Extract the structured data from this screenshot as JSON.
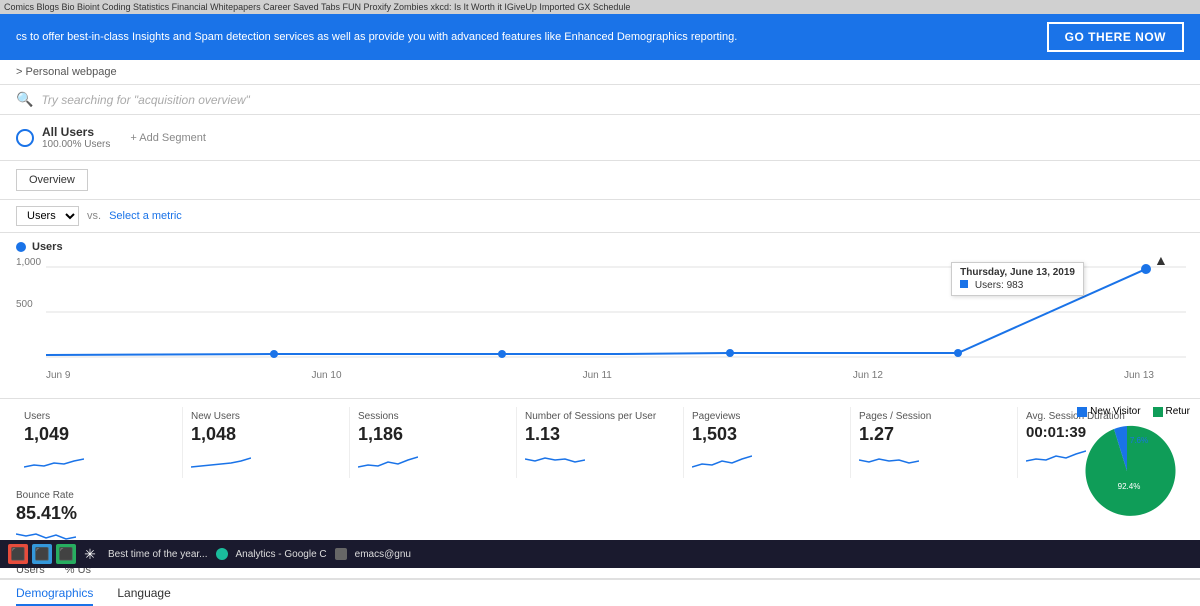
{
  "browser": {
    "tabs": "Comics  Blogs  Bio  Bioint  Coding  Statistics  Financial  Whitepapers  Career  Saved Tabs  FUN  Proxify  Zombies  xkcd: Is It Worth it  IGiveUp  Imported  GX Schedule"
  },
  "notification": {
    "message": "cs to offer best-in-class Insights and Spam detection services as well as provide you with advanced features like Enhanced Demographics reporting.",
    "cta_label": "GO THERE NOW"
  },
  "breadcrumb": {
    "label": "> Personal webpage"
  },
  "search": {
    "placeholder": "Try searching for \"acquisition overview\""
  },
  "segments": {
    "all_users_label": "All Users",
    "all_users_sub": "100.00% Users",
    "add_segment_label": "+ Add Segment"
  },
  "tabs": {
    "overview_label": "Overview"
  },
  "metrics": {
    "dimension": "Users",
    "vs_label": "vs.",
    "select_label": "Select a metric"
  },
  "chart": {
    "legend_label": "Users",
    "y_labels": [
      "1,000",
      "500"
    ],
    "x_labels": [
      "Jun 9",
      "Jun 10",
      "Jun 11",
      "Jun 12",
      "Jun 13"
    ],
    "tooltip": {
      "date": "Thursday, June 13, 2019",
      "metric": "Users: 983"
    }
  },
  "stats": [
    {
      "label": "Users",
      "value": "1,049"
    },
    {
      "label": "New Users",
      "value": "1,048"
    },
    {
      "label": "Sessions",
      "value": "1,186"
    },
    {
      "label": "Number of Sessions per User",
      "value": "1.13"
    },
    {
      "label": "Pageviews",
      "value": "1,503"
    },
    {
      "label": "Pages / Session",
      "value": "1.27"
    },
    {
      "label": "Avg. Session Duration",
      "value": "00:01:39"
    }
  ],
  "bounce": {
    "label": "Bounce Rate",
    "value": "85.41%"
  },
  "pie": {
    "legend": [
      {
        "label": "New Visitor",
        "color": "#1a73e8",
        "pct": "7.6%"
      },
      {
        "label": "Retur",
        "color": "#0f9d58",
        "pct": "92.4%"
      }
    ]
  },
  "bottom_tabs": [
    {
      "label": "Demographics",
      "active": true
    },
    {
      "label": "Language",
      "active": false
    }
  ],
  "taskbar": {
    "items": [
      "Best time of the year...",
      "Analytics - Google C",
      "emacs@gnu"
    ]
  }
}
